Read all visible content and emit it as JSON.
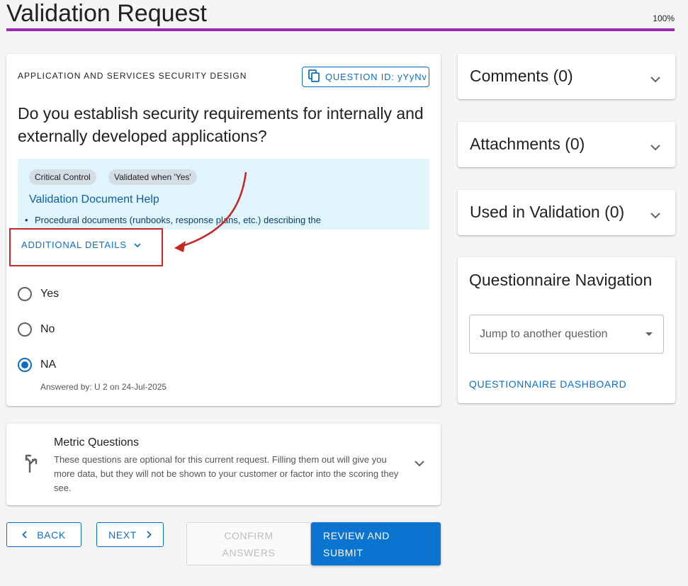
{
  "header": {
    "title": "Validation Request",
    "progress_label": "100%",
    "progress_value": 1.0,
    "progress_color": "#9c27b0"
  },
  "question": {
    "section": "APPLICATION AND SERVICES SECURITY DESIGN",
    "id_label": "QUESTION ID: yYyNv",
    "text": "Do you establish security requirements for internally and externally developed applications?",
    "chips": [
      "Critical Control",
      "Validated when 'Yes'"
    ],
    "help_title": "Validation Document Help",
    "help_bullet": "Procedural documents (runbooks, response plans, etc.) describing the",
    "details_toggle": "ADDITIONAL DETAILS",
    "options": [
      {
        "label": "Yes",
        "selected": false
      },
      {
        "label": "No",
        "selected": false
      },
      {
        "label": "NA",
        "selected": true
      }
    ],
    "answered_by": "Answered by: U 2 on 24-Jul-2025"
  },
  "metric": {
    "title": "Metric Questions",
    "description": "These questions are optional for this current request. Filling them out will give you more data, but they will not be shown to your customer or factor into the scoring they see."
  },
  "actions": {
    "back": "BACK",
    "next": "NEXT",
    "confirm_line1": "CONFIRM",
    "confirm_line2": "ANSWERS",
    "submit_line1": "REVIEW AND",
    "submit_line2": "SUBMIT"
  },
  "sidebar": {
    "comments": "Comments (0)",
    "attachments": "Attachments (0)",
    "used_in_validation": "Used in Validation (0)",
    "nav_title": "Questionnaire Navigation",
    "jump_placeholder": "Jump to another question",
    "dashboard_link": "QUESTIONNAIRE DASHBOARD"
  },
  "colors": {
    "primary": "#0b6fc4",
    "annotation": "#c62828",
    "help_background": "#e1f5fd"
  },
  "icons": {
    "question_id": "copy-icon",
    "metric": "split-arrow-icon",
    "expand": "chevron-down-icon",
    "back": "chevron-left-icon",
    "next": "chevron-right-icon"
  }
}
